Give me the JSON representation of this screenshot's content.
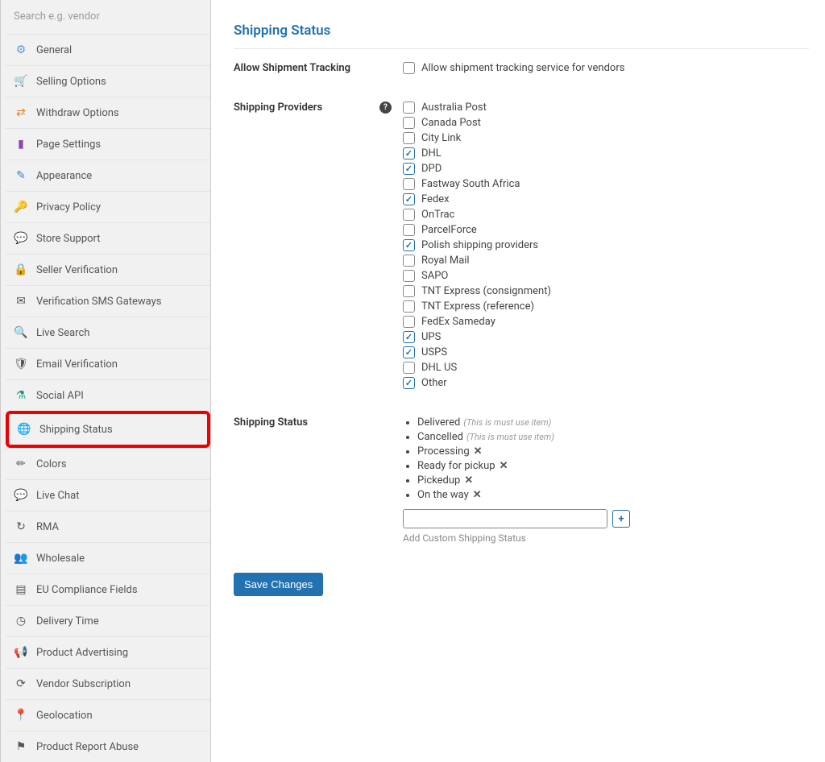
{
  "search": {
    "placeholder": "Search e.g. vendor"
  },
  "sidebar": {
    "items": [
      {
        "label": "General",
        "icon": "⚙",
        "color": "#5a9bd4"
      },
      {
        "label": "Selling Options",
        "icon": "🛒",
        "color": "#1abc9c"
      },
      {
        "label": "Withdraw Options",
        "icon": "⇄",
        "color": "#e67e22"
      },
      {
        "label": "Page Settings",
        "icon": "▮",
        "color": "#8e44ad"
      },
      {
        "label": "Appearance",
        "icon": "✎",
        "color": "#2e86de"
      },
      {
        "label": "Privacy Policy",
        "icon": "🔑",
        "color": "#555"
      },
      {
        "label": "Store Support",
        "icon": "💬",
        "color": "#555"
      },
      {
        "label": "Seller Verification",
        "icon": "🔒",
        "color": "#555"
      },
      {
        "label": "Verification SMS Gateways",
        "icon": "✉",
        "color": "#555"
      },
      {
        "label": "Live Search",
        "icon": "🔍",
        "color": "#555"
      },
      {
        "label": "Email Verification",
        "icon": "🛡",
        "color": "#555"
      },
      {
        "label": "Social API",
        "icon": "⚗",
        "color": "#16a085"
      },
      {
        "label": "Shipping Status",
        "icon": "🌐",
        "color": "#555",
        "highlight": true
      },
      {
        "label": "Colors",
        "icon": "✏",
        "color": "#555"
      },
      {
        "label": "Live Chat",
        "icon": "💬",
        "color": "#555"
      },
      {
        "label": "RMA",
        "icon": "↻",
        "color": "#555"
      },
      {
        "label": "Wholesale",
        "icon": "👥",
        "color": "#555"
      },
      {
        "label": "EU Compliance Fields",
        "icon": "▤",
        "color": "#555"
      },
      {
        "label": "Delivery Time",
        "icon": "◷",
        "color": "#555"
      },
      {
        "label": "Product Advertising",
        "icon": "📢",
        "color": "#555"
      },
      {
        "label": "Vendor Subscription",
        "icon": "⟳",
        "color": "#555"
      },
      {
        "label": "Geolocation",
        "icon": "📍",
        "color": "#555"
      },
      {
        "label": "Product Report Abuse",
        "icon": "⚑",
        "color": "#555"
      }
    ]
  },
  "main": {
    "title": "Shipping Status",
    "tracking": {
      "label": "Allow Shipment Tracking",
      "checkbox_label": "Allow shipment tracking service for vendors",
      "checked": false
    },
    "providers": {
      "label": "Shipping Providers",
      "items": [
        {
          "label": "Australia Post",
          "checked": false
        },
        {
          "label": "Canada Post",
          "checked": false
        },
        {
          "label": "City Link",
          "checked": false
        },
        {
          "label": "DHL",
          "checked": true
        },
        {
          "label": "DPD",
          "checked": true
        },
        {
          "label": "Fastway South Africa",
          "checked": false
        },
        {
          "label": "Fedex",
          "checked": true
        },
        {
          "label": "OnTrac",
          "checked": false
        },
        {
          "label": "ParcelForce",
          "checked": false
        },
        {
          "label": "Polish shipping providers",
          "checked": true
        },
        {
          "label": "Royal Mail",
          "checked": false
        },
        {
          "label": "SAPO",
          "checked": false
        },
        {
          "label": "TNT Express (consignment)",
          "checked": false
        },
        {
          "label": "TNT Express (reference)",
          "checked": false
        },
        {
          "label": "FedEx Sameday",
          "checked": false
        },
        {
          "label": "UPS",
          "checked": true
        },
        {
          "label": "USPS",
          "checked": true
        },
        {
          "label": "DHL US",
          "checked": false
        },
        {
          "label": "Other",
          "checked": true
        }
      ]
    },
    "status": {
      "label": "Shipping Status",
      "must_use_hint": "(This is must use item)",
      "items": [
        {
          "label": "Delivered",
          "must_use": true
        },
        {
          "label": "Cancelled",
          "must_use": true
        },
        {
          "label": "Processing",
          "removable": true
        },
        {
          "label": "Ready for pickup",
          "removable": true
        },
        {
          "label": "Pickedup",
          "removable": true
        },
        {
          "label": "On the way",
          "removable": true
        }
      ],
      "add_helper": "Add Custom Shipping Status"
    },
    "save_label": "Save Changes"
  }
}
